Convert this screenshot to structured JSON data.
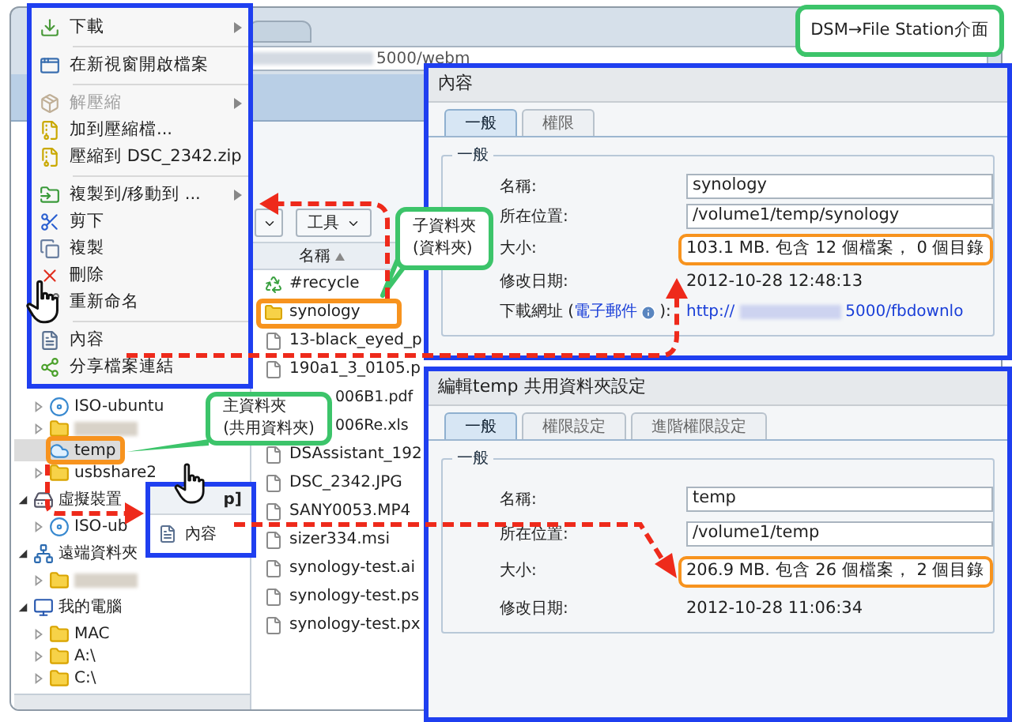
{
  "browser": {
    "address": "5000/webm"
  },
  "context_menu": [
    {
      "kind": "item",
      "label": "下載",
      "submenu": true,
      "disabled": false
    },
    {
      "kind": "separator"
    },
    {
      "kind": "item",
      "label": "在新視窗開啟檔案",
      "submenu": false,
      "disabled": false
    },
    {
      "kind": "separator"
    },
    {
      "kind": "item",
      "label": "解壓縮",
      "submenu": true,
      "disabled": true
    },
    {
      "kind": "item",
      "label": "加到壓縮檔...",
      "submenu": false,
      "disabled": false
    },
    {
      "kind": "item",
      "label": "壓縮到 DSC_2342.zip",
      "submenu": false,
      "disabled": false
    },
    {
      "kind": "separator"
    },
    {
      "kind": "item",
      "label": "複製到/移動到 ...",
      "submenu": true,
      "disabled": false
    },
    {
      "kind": "item",
      "label": "剪下",
      "submenu": false,
      "disabled": false
    },
    {
      "kind": "item",
      "label": "複製",
      "submenu": false,
      "disabled": false
    },
    {
      "kind": "item",
      "label": "刪除",
      "submenu": false,
      "disabled": false
    },
    {
      "kind": "item",
      "label": "重新命名",
      "submenu": false,
      "disabled": false
    },
    {
      "kind": "separator"
    },
    {
      "kind": "item",
      "label": "內容",
      "submenu": false,
      "disabled": false
    },
    {
      "kind": "item",
      "label": "分享檔案連結",
      "submenu": false,
      "disabled": false
    }
  ],
  "tree": [
    {
      "children": [
        {
          "kind": "disc",
          "label": "ISO-ubuntu",
          "expanded": false,
          "selected": false,
          "highlighted": false
        },
        {
          "kind": "blurred",
          "expanded": false,
          "selected": false,
          "highlighted": false
        },
        {
          "kind": "cloud",
          "label": "temp",
          "selected": true,
          "highlighted": true
        },
        {
          "kind": "folder",
          "label": "usbshare2",
          "expanded": false,
          "selected": false,
          "highlighted": false
        }
      ]
    },
    {
      "kind": "drive",
      "label": "虛擬裝置",
      "expanded": true,
      "children": [
        {
          "kind": "disc",
          "label": "ISO-ub",
          "expanded": false,
          "selected": false,
          "highlighted": false
        }
      ]
    },
    {
      "kind": "network",
      "label": "遠端資料夾",
      "expanded": true,
      "children": [
        {
          "kind": "blurred",
          "expanded": false,
          "selected": false,
          "highlighted": false
        }
      ]
    },
    {
      "kind": "computer",
      "label": "我的電腦",
      "expanded": true,
      "children": [
        {
          "kind": "folder",
          "label": "MAC",
          "expanded": false,
          "selected": false,
          "highlighted": false
        },
        {
          "kind": "folder",
          "label": "A:\\",
          "expanded": false,
          "selected": false,
          "highlighted": false
        },
        {
          "kind": "folder",
          "label": "C:\\",
          "expanded": false,
          "selected": false,
          "highlighted": false
        }
      ]
    }
  ],
  "file_list": {
    "toolbar": [
      {
        "kind": "caret"
      },
      {
        "kind": "labeled",
        "label": "工具"
      }
    ],
    "column": "名稱",
    "rows": [
      {
        "kind": "recycle",
        "name": "#recycle",
        "highlighted": false
      },
      {
        "kind": "folder",
        "name": "synology",
        "highlighted": true
      },
      {
        "kind": "file",
        "name": "13-black_eyed_p",
        "highlighted": false
      },
      {
        "kind": "file",
        "name": "190a1_3_0105.p",
        "highlighted": false
      },
      {
        "kind": "partial",
        "name": "006B1.pdf",
        "highlighted": false
      },
      {
        "kind": "partial",
        "name": "006Re.xls",
        "highlighted": false
      },
      {
        "kind": "file",
        "name": "DSAssistant_192",
        "highlighted": false
      },
      {
        "kind": "file",
        "name": "DSC_2342.JPG",
        "highlighted": false
      },
      {
        "kind": "file",
        "name": "SANY0053.MP4",
        "highlighted": false
      },
      {
        "kind": "file",
        "name": "sizer334.msi",
        "highlighted": false
      },
      {
        "kind": "file",
        "name": "synology-test.ai",
        "highlighted": false
      },
      {
        "kind": "file",
        "name": "synology-test.ps",
        "highlighted": false
      },
      {
        "kind": "file",
        "name": "synology-test.px",
        "highlighted": false
      }
    ]
  },
  "popup": {
    "header": "p]",
    "item": "內容"
  },
  "dialogs": [
    {
      "title": "內容",
      "tabs": [
        {
          "label": "一般",
          "selected": true
        },
        {
          "label": "權限",
          "selected": false
        }
      ],
      "legend": "一般",
      "fields": [
        {
          "kind": "input",
          "label": "名稱:",
          "value": "synology"
        },
        {
          "kind": "input",
          "label": "所在位置:",
          "value": "/volume1/temp/synology"
        },
        {
          "kind": "text",
          "label": "大小:",
          "value": "103.1 MB. 包含 12 個檔案， 0 個目錄",
          "highlighted": true
        },
        {
          "kind": "text",
          "label": "修改日期:",
          "value": "2012-10-28 12:48:13",
          "highlighted": false
        },
        {
          "kind": "url",
          "label": "下載網址 (",
          "link": "電子郵件",
          "label_end": "):",
          "value": "http://",
          "value_end": "5000/fbdownlo"
        }
      ]
    },
    {
      "title": "編輯temp 共用資料夾設定",
      "tabs": [
        {
          "label": "一般",
          "selected": true
        },
        {
          "label": "權限設定",
          "selected": false
        },
        {
          "label": "進階權限設定",
          "selected": false
        }
      ],
      "legend": "一般",
      "fields": [
        {
          "kind": "input",
          "label": "名稱:",
          "value": "temp"
        },
        {
          "kind": "input",
          "label": "所在位置:",
          "value": "/volume1/temp"
        },
        {
          "kind": "text",
          "label": "大小:",
          "value": "206.9 MB. 包含 26 個檔案， 2 個目錄",
          "highlighted": true
        },
        {
          "kind": "text",
          "label": "修改日期:",
          "value": "2012-10-28 11:06:34",
          "highlighted": false
        }
      ]
    }
  ],
  "callouts": [
    {
      "text": "DSM→File Station介面"
    },
    {
      "text": "子資料夾\n(資料夾)"
    },
    {
      "text": "主資料夾\n(共用資料夾)"
    }
  ]
}
